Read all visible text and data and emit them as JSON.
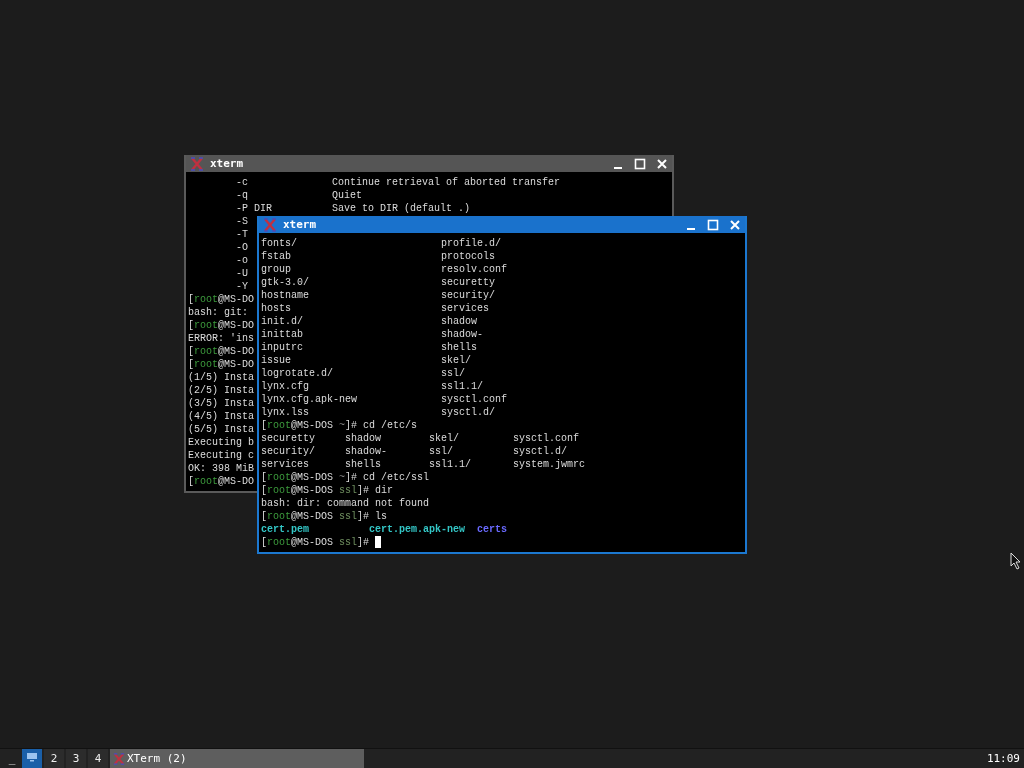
{
  "windows": [
    {
      "title": "xterm",
      "active": false,
      "lines": [
        {
          "kind": "option",
          "cells": [
            "-c",
            "Continue retrieval of aborted transfer"
          ]
        },
        {
          "kind": "option",
          "cells": [
            "-q",
            "Quiet"
          ]
        },
        {
          "kind": "option",
          "cells": [
            "-P DIR",
            "Save to DIR (default .)"
          ]
        },
        {
          "kind": "option",
          "cells": [
            "-S"
          ]
        },
        {
          "kind": "option",
          "cells": [
            "-T"
          ]
        },
        {
          "kind": "option",
          "cells": [
            "-O"
          ]
        },
        {
          "kind": "option",
          "cells": [
            "-o"
          ]
        },
        {
          "kind": "option",
          "cells": [
            "-U"
          ]
        },
        {
          "kind": "option",
          "cells": [
            "-Y"
          ]
        },
        {
          "kind": "segments",
          "segments": [
            {
              "kind": "plain",
              "text": "["
            },
            {
              "kind": "user",
              "text": "root"
            },
            {
              "kind": "plain",
              "text": "@MS-DO"
            }
          ]
        },
        {
          "kind": "columns",
          "cells": [
            "bash: git:"
          ]
        },
        {
          "kind": "segments",
          "segments": [
            {
              "kind": "plain",
              "text": "["
            },
            {
              "kind": "user",
              "text": "root"
            },
            {
              "kind": "plain",
              "text": "@MS-DO"
            }
          ]
        },
        {
          "kind": "columns",
          "cells": [
            "ERROR: 'ins"
          ]
        },
        {
          "kind": "segments",
          "segments": [
            {
              "kind": "plain",
              "text": "["
            },
            {
              "kind": "user",
              "text": "root"
            },
            {
              "kind": "plain",
              "text": "@MS-DO"
            }
          ]
        },
        {
          "kind": "segments",
          "segments": [
            {
              "kind": "plain",
              "text": "["
            },
            {
              "kind": "user",
              "text": "root"
            },
            {
              "kind": "plain",
              "text": "@MS-DO"
            }
          ]
        },
        {
          "kind": "columns",
          "cells": [
            "(1/5) Insta"
          ]
        },
        {
          "kind": "columns",
          "cells": [
            "(2/5) Insta"
          ]
        },
        {
          "kind": "columns",
          "cells": [
            "(3/5) Insta"
          ]
        },
        {
          "kind": "columns",
          "cells": [
            "(4/5) Insta"
          ]
        },
        {
          "kind": "columns",
          "cells": [
            "(5/5) Insta"
          ]
        },
        {
          "kind": "columns",
          "cells": [
            "Executing b"
          ]
        },
        {
          "kind": "columns",
          "cells": [
            "Executing c"
          ]
        },
        {
          "kind": "columns",
          "cells": [
            "OK: 398 MiB"
          ]
        },
        {
          "kind": "segments",
          "segments": [
            {
              "kind": "plain",
              "text": "["
            },
            {
              "kind": "user",
              "text": "root"
            },
            {
              "kind": "plain",
              "text": "@MS-DO"
            }
          ]
        }
      ]
    },
    {
      "title": "xterm",
      "active": true,
      "lines": [
        {
          "kind": "columns",
          "cells": [
            "fonts/",
            "profile.d/"
          ]
        },
        {
          "kind": "columns",
          "cells": [
            "fstab",
            "protocols"
          ]
        },
        {
          "kind": "columns",
          "cells": [
            "group",
            "resolv.conf"
          ]
        },
        {
          "kind": "columns",
          "cells": [
            "gtk-3.0/",
            "securetty"
          ]
        },
        {
          "kind": "columns",
          "cells": [
            "hostname",
            "security/"
          ]
        },
        {
          "kind": "columns",
          "cells": [
            "hosts",
            "services"
          ]
        },
        {
          "kind": "columns",
          "cells": [
            "init.d/",
            "shadow"
          ]
        },
        {
          "kind": "columns",
          "cells": [
            "inittab",
            "shadow-"
          ]
        },
        {
          "kind": "columns",
          "cells": [
            "inputrc",
            "shells"
          ]
        },
        {
          "kind": "columns",
          "cells": [
            "issue",
            "skel/"
          ]
        },
        {
          "kind": "columns",
          "cells": [
            "logrotate.d/",
            "ssl/"
          ]
        },
        {
          "kind": "columns",
          "cells": [
            "lynx.cfg",
            "ssl1.1/"
          ]
        },
        {
          "kind": "columns",
          "cells": [
            "lynx.cfg.apk-new",
            "sysctl.conf"
          ]
        },
        {
          "kind": "columns",
          "cells": [
            "lynx.lss",
            "sysctl.d/"
          ]
        },
        {
          "kind": "segments",
          "segments": [
            {
              "kind": "plain",
              "text": "["
            },
            {
              "kind": "user",
              "text": "root"
            },
            {
              "kind": "plain",
              "text": "@MS-DOS "
            },
            {
              "kind": "home",
              "text": "~"
            },
            {
              "kind": "plain",
              "text": "]# cd /etc/s"
            }
          ]
        },
        {
          "kind": "columns",
          "cells": [
            "securetty",
            "shadow",
            "skel/",
            "sysctl.conf"
          ]
        },
        {
          "kind": "columns",
          "cells": [
            "security/",
            "shadow-",
            "ssl/",
            "sysctl.d/"
          ]
        },
        {
          "kind": "columns",
          "cells": [
            "services",
            "shells",
            "ssl1.1/",
            "system.jwmrc"
          ]
        },
        {
          "kind": "segments",
          "segments": [
            {
              "kind": "plain",
              "text": "["
            },
            {
              "kind": "user",
              "text": "root"
            },
            {
              "kind": "plain",
              "text": "@MS-DOS "
            },
            {
              "kind": "home",
              "text": "~"
            },
            {
              "kind": "plain",
              "text": "]# cd /etc/ssl"
            }
          ]
        },
        {
          "kind": "segments",
          "segments": [
            {
              "kind": "plain",
              "text": "["
            },
            {
              "kind": "user",
              "text": "root"
            },
            {
              "kind": "plain",
              "text": "@MS-DOS "
            },
            {
              "kind": "dir",
              "text": "ssl"
            },
            {
              "kind": "plain",
              "text": "]# dir"
            }
          ]
        },
        {
          "kind": "columns",
          "cells": [
            "bash: dir: command not found"
          ]
        },
        {
          "kind": "segments",
          "segments": [
            {
              "kind": "plain",
              "text": "["
            },
            {
              "kind": "user",
              "text": "root"
            },
            {
              "kind": "plain",
              "text": "@MS-DOS "
            },
            {
              "kind": "dir",
              "text": "ssl"
            },
            {
              "kind": "plain",
              "text": "]# ls"
            }
          ]
        },
        {
          "kind": "colored-columns",
          "cells": [
            {
              "text": "cert.pem",
              "color": "#33c6c6"
            },
            {
              "text": "cert.pem.apk-new",
              "color": "#33c6c6"
            },
            {
              "text": "certs",
              "color": "#6a6aff"
            }
          ]
        },
        {
          "kind": "segments",
          "cursor": true,
          "segments": [
            {
              "kind": "plain",
              "text": "["
            },
            {
              "kind": "user",
              "text": "root"
            },
            {
              "kind": "plain",
              "text": "@MS-DOS "
            },
            {
              "kind": "dir",
              "text": "ssl"
            },
            {
              "kind": "plain",
              "text": "]# "
            }
          ]
        }
      ]
    }
  ],
  "taskbar": {
    "show_desktop": "_",
    "desktops": [
      {
        "kind": "icon",
        "selected": true
      },
      {
        "kind": "number",
        "label": "2",
        "selected": false
      },
      {
        "kind": "number",
        "label": "3",
        "selected": false
      },
      {
        "kind": "number",
        "label": "4",
        "selected": false
      }
    ],
    "tasks": [
      {
        "label": "XTerm (2)"
      }
    ],
    "clock": "11:09"
  }
}
